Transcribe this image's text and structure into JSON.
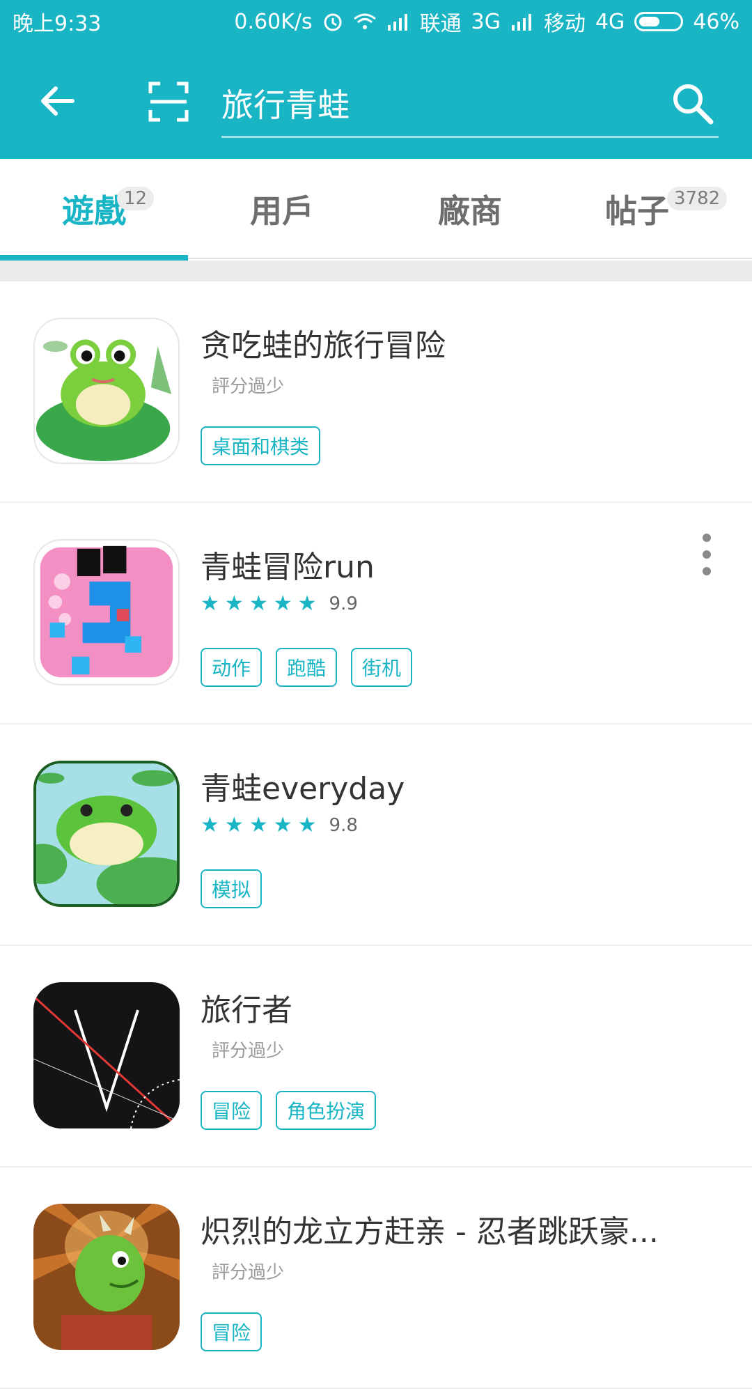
{
  "status_bar": {
    "time": "晚上9:33",
    "speed": "0.60K/s",
    "carrier1": "联通",
    "network1": "3G",
    "carrier2": "移动",
    "network2": "4G",
    "battery": "46%"
  },
  "search": {
    "query": "旅行青蛙",
    "back_icon": "arrow-left-icon",
    "scan_icon": "scan-icon",
    "search_icon": "search-icon"
  },
  "tabs": [
    {
      "label": "遊戲",
      "badge": "12",
      "active": true
    },
    {
      "label": "用戶",
      "badge": "",
      "active": false
    },
    {
      "label": "廠商",
      "badge": "",
      "active": false
    },
    {
      "label": "帖子",
      "badge": "3782",
      "active": false
    }
  ],
  "accent_color": "#1ab5c5",
  "games": [
    {
      "title": "贪吃蛙的旅行冒险",
      "rating": "評分過少",
      "score": "",
      "tags": [
        "桌面和棋类"
      ]
    },
    {
      "title": "青蛙冒险run",
      "rating": "",
      "score": "9.9",
      "tags": [
        "动作",
        "跑酷",
        "街机"
      ]
    },
    {
      "title": "青蛙everyday",
      "rating": "",
      "score": "9.8",
      "tags": [
        "模拟"
      ]
    },
    {
      "title": "旅行者",
      "rating": "評分過少",
      "score": "",
      "tags": [
        "冒险",
        "角色扮演"
      ]
    },
    {
      "title": "炽烈的龙立方赶亲 - 忍者跳跃豪...",
      "rating": "評分過少",
      "score": "",
      "tags": [
        "冒险"
      ]
    }
  ]
}
